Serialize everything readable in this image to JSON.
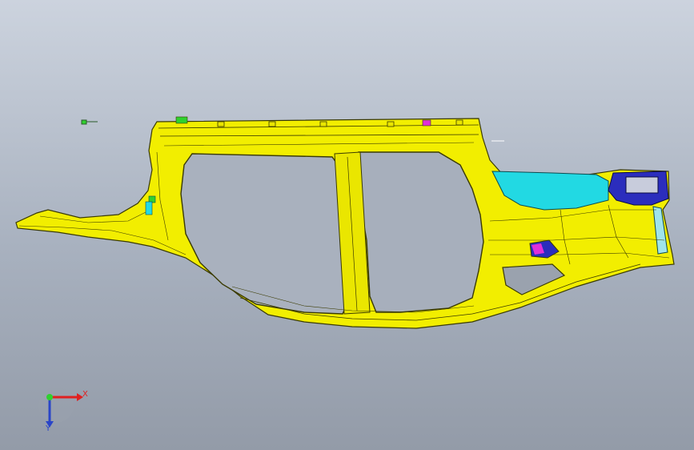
{
  "viewport": {
    "background_top": "#ccd3de",
    "background_bottom": "#939ba8"
  },
  "model": {
    "part_color": "#f2ee00",
    "part_edge_color": "#3a3a00",
    "bracket_cyan": "#22d9e3",
    "bracket_blue": "#2b2dbd",
    "accent_magenta": "#e02fd8",
    "accent_green": "#2fd12f"
  },
  "triad": {
    "x_label": "X",
    "y_label": "Y",
    "x_color": "#e02020",
    "y_color": "#2a45c8",
    "origin_color": "#2fd12f"
  }
}
